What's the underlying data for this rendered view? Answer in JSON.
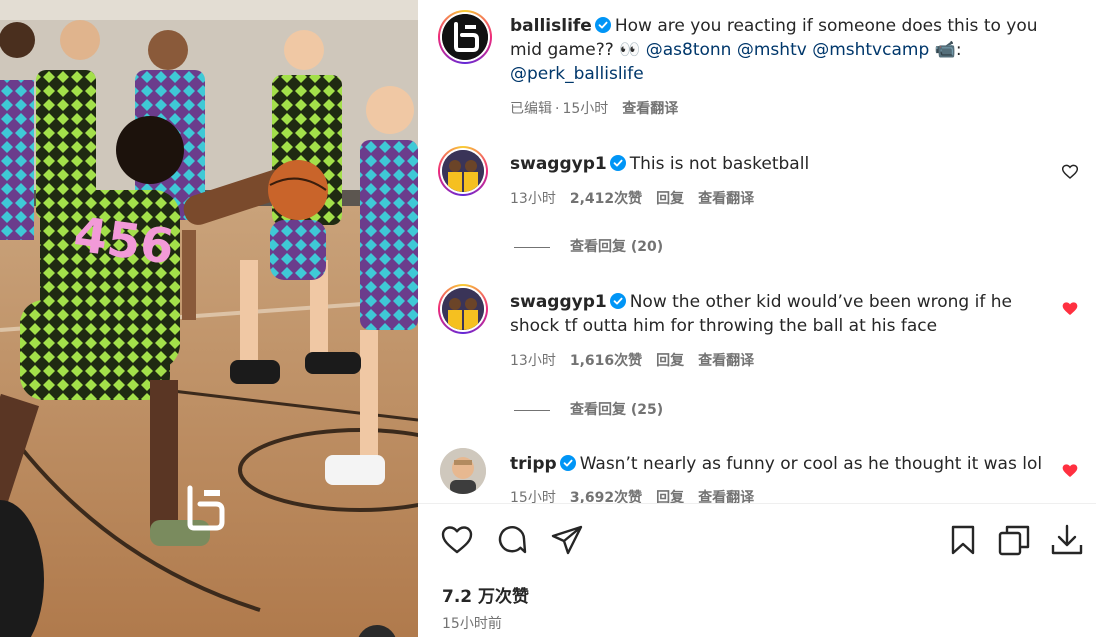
{
  "post": {
    "username": "ballislife",
    "caption_text": "How are you reacting if someone does this to you mid game??",
    "caption_emoji": "👀",
    "mentions": [
      "@as8tonn",
      "@mshtv",
      "@mshtvcamp"
    ],
    "caption_emoji_2": "📹:",
    "mention_last": "@perk_ballislife",
    "edited_label": "已编辑",
    "separator": "·",
    "time_ago": "15小时",
    "translate_label": "查看翻译"
  },
  "comments": [
    {
      "username": "swaggyp1",
      "text": "This is not basketball",
      "time": "13小时",
      "likes": "2,412次赞",
      "reply_label": "回复",
      "translate_label": "查看翻译",
      "view_replies": "查看回复 (20)",
      "liked": false
    },
    {
      "username": "swaggyp1",
      "text": "Now the other kid would’ve been wrong if he shock tf outta him for throwing the ball at his face",
      "time": "13小时",
      "likes": "1,616次赞",
      "reply_label": "回复",
      "translate_label": "查看翻译",
      "view_replies": "查看回复 (25)",
      "liked": true
    },
    {
      "username": "tripp",
      "text": "Wasn’t nearly as funny or cool as he thought it was lol",
      "time": "15小时",
      "likes": "3,692次赞",
      "reply_label": "回复",
      "translate_label": "查看翻译",
      "liked": true
    }
  ],
  "footer": {
    "likes_count": "7.2 万次赞",
    "posted_time": "15小时前"
  },
  "colors": {
    "verified": "#0095f6",
    "liked_heart": "#ff3040",
    "mention": "#00376b",
    "muted_text": "#737373"
  },
  "icons": [
    "verified-badge-icon",
    "heart-icon",
    "comment-icon",
    "share-icon",
    "bookmark-icon",
    "copy-icon",
    "download-icon"
  ]
}
